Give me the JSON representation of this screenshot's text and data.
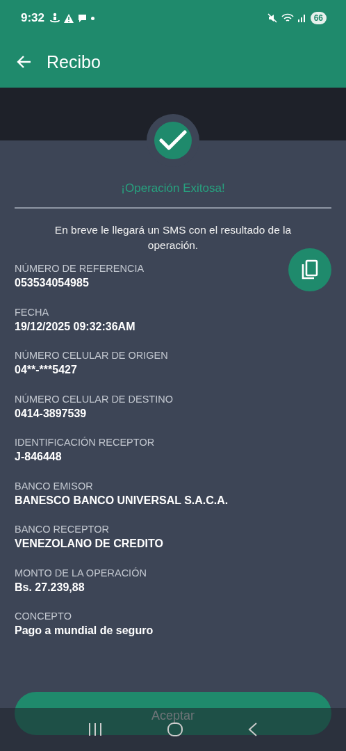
{
  "status_bar": {
    "time": "9:32",
    "battery": "66"
  },
  "app_bar": {
    "title": "Recibo"
  },
  "result": {
    "title": "¡Operación Exitosa!",
    "message": "En breve le llegará un SMS con el resultado de la operación."
  },
  "fields": [
    {
      "label": "NÚMERO DE REFERENCIA",
      "value": "053534054985"
    },
    {
      "label": "FECHA",
      "value": "19/12/2025 09:32:36AM"
    },
    {
      "label": "NÚMERO CELULAR DE ORIGEN",
      "value": "04**-***5427"
    },
    {
      "label": "NÚMERO CELULAR DE DESTINO",
      "value": "0414-3897539"
    },
    {
      "label": "IDENTIFICACIÓN RECEPTOR",
      "value": "J-846448"
    },
    {
      "label": "BANCO EMISOR",
      "value": "BANESCO BANCO UNIVERSAL S.A.C.A."
    },
    {
      "label": "BANCO RECEPTOR",
      "value": "VENEZOLANO DE CREDITO"
    },
    {
      "label": "MONTO DE LA OPERACIÓN",
      "value": "Bs. 27.239,88"
    },
    {
      "label": "CONCEPTO",
      "value": "Pago a mundial de seguro"
    }
  ],
  "accept_button": {
    "label": "Aceptar"
  }
}
